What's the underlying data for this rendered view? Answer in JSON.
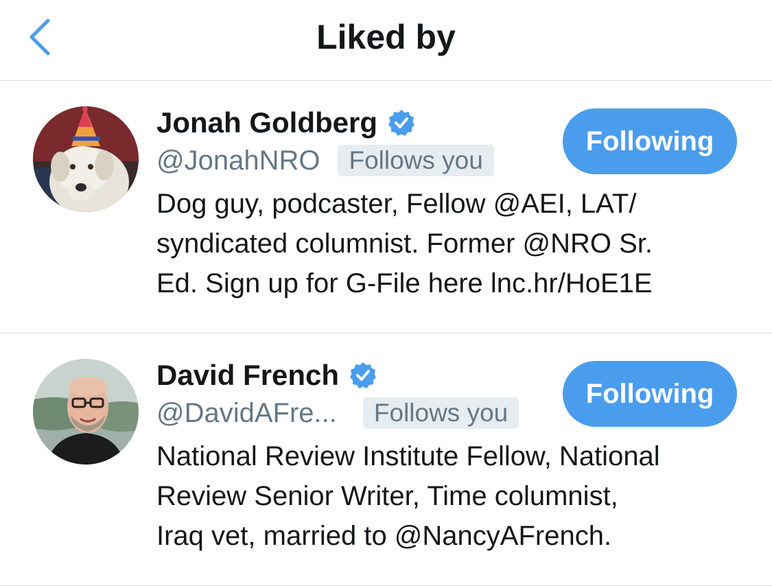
{
  "nav": {
    "title": "Liked by",
    "back_icon": "chevron-left-icon"
  },
  "colors": {
    "accent": "#4a9ded",
    "secondary_text": "#657786",
    "badge_bg": "#e6ecf0",
    "divider": "#d9dde0"
  },
  "users": [
    {
      "display_name": "Jonah Goldberg",
      "verified": true,
      "handle": "@JonahNRO",
      "follows_you_label": "Follows you",
      "button_label": "Following",
      "bio_lines": [
        "Dog guy, podcaster, Fellow @AEI, LAT/",
        "syndicated columnist. Former @NRO Sr.",
        "Ed. Sign up for G-File here lnc.hr/HoE1E"
      ]
    },
    {
      "display_name": "David French",
      "verified": true,
      "handle": "@DavidAFre...",
      "follows_you_label": "Follows you",
      "button_label": "Following",
      "bio_lines": [
        "National Review Institute Fellow, National",
        "Review Senior Writer, Time columnist,",
        "Iraq vet, married to @NancyAFrench."
      ]
    }
  ]
}
